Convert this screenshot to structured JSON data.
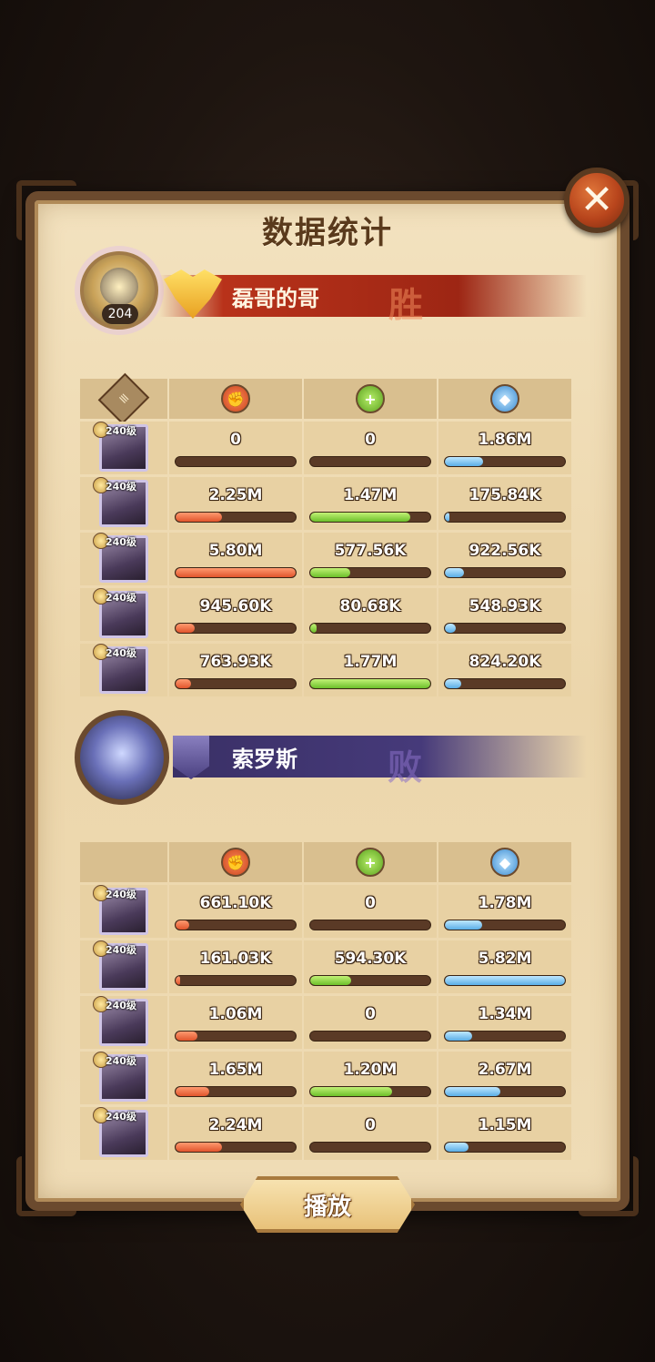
{
  "title": "数据统计",
  "close_label": "✕",
  "team1": {
    "name": "磊哥的哥",
    "result": "胜",
    "player_level": "204",
    "heroes": [
      {
        "level": "240级",
        "damage": "0",
        "damage_frac": 0,
        "heal": "0",
        "heal_frac": 0,
        "defense": "1.86M",
        "defense_frac": 0.32
      },
      {
        "level": "240级",
        "damage": "2.25M",
        "damage_frac": 0.39,
        "heal": "1.47M",
        "heal_frac": 0.83,
        "defense": "175.84K",
        "defense_frac": 0.03
      },
      {
        "level": "240级",
        "damage": "5.80M",
        "damage_frac": 1.0,
        "heal": "577.56K",
        "heal_frac": 0.33,
        "defense": "922.56K",
        "defense_frac": 0.16
      },
      {
        "level": "240级",
        "damage": "945.60K",
        "damage_frac": 0.16,
        "heal": "80.68K",
        "heal_frac": 0.05,
        "defense": "548.93K",
        "defense_frac": 0.09
      },
      {
        "level": "240级",
        "damage": "763.93K",
        "damage_frac": 0.13,
        "heal": "1.77M",
        "heal_frac": 1.0,
        "defense": "824.20K",
        "defense_frac": 0.14
      }
    ]
  },
  "team2": {
    "name": "索罗斯",
    "result": "败",
    "heroes": [
      {
        "level": "240级",
        "damage": "661.10K",
        "damage_frac": 0.11,
        "heal": "0",
        "heal_frac": 0,
        "defense": "1.78M",
        "defense_frac": 0.31
      },
      {
        "level": "240级",
        "damage": "161.03K",
        "damage_frac": 0.03,
        "heal": "594.30K",
        "heal_frac": 0.34,
        "defense": "5.82M",
        "defense_frac": 1.0
      },
      {
        "level": "240级",
        "damage": "1.06M",
        "damage_frac": 0.18,
        "heal": "0",
        "heal_frac": 0,
        "defense": "1.34M",
        "defense_frac": 0.23
      },
      {
        "level": "240级",
        "damage": "1.65M",
        "damage_frac": 0.28,
        "heal": "1.20M",
        "heal_frac": 0.68,
        "defense": "2.67M",
        "defense_frac": 0.46
      },
      {
        "level": "240级",
        "damage": "2.24M",
        "damage_frac": 0.39,
        "heal": "0",
        "heal_frac": 0,
        "defense": "1.15M",
        "defense_frac": 0.2
      }
    ]
  },
  "icons": {
    "damage": "damage-icon",
    "heal": "heal-icon",
    "defense": "defense-icon",
    "report": "report-icon"
  },
  "colors": {
    "damage": "#e0542c",
    "heal": "#6cbf2a",
    "defense": "#5aaee6",
    "win_banner": "#b8321a",
    "lose_banner": "#463a7a"
  },
  "play_label": "播放"
}
